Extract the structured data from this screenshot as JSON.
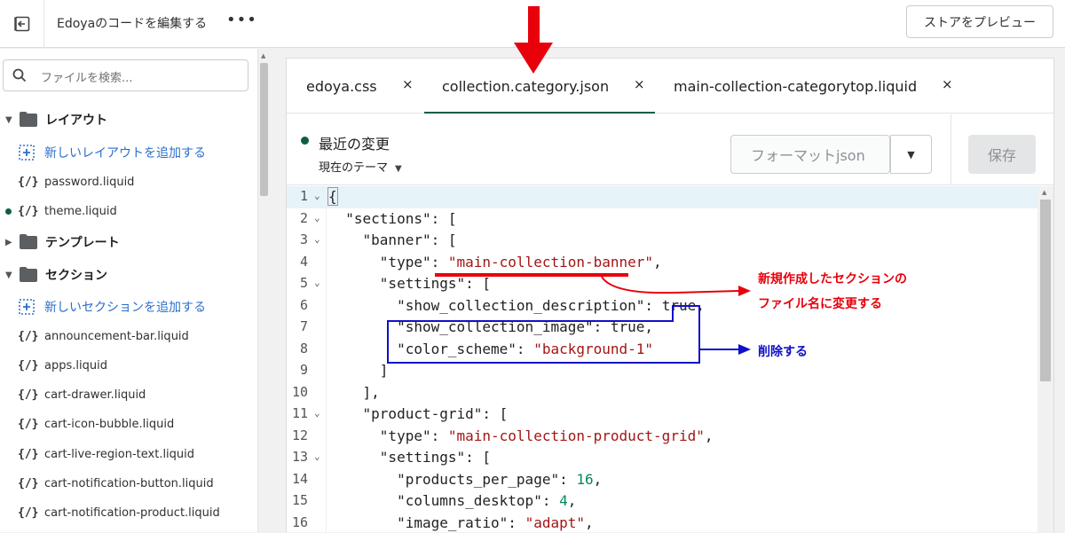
{
  "topbar": {
    "title": "Edoyaのコードを編集する",
    "more": "•••",
    "preview_label": "ストアをプレビュー"
  },
  "sidebar": {
    "search_placeholder": "ファイルを検索...",
    "layout_folder": "レイアウト",
    "add_layout": "新しいレイアウトを追加する",
    "layout_files": [
      "password.liquid",
      "theme.liquid"
    ],
    "template_folder": "テンプレート",
    "section_folder": "セクション",
    "add_section": "新しいセクションを追加する",
    "section_files": [
      "announcement-bar.liquid",
      "apps.liquid",
      "cart-drawer.liquid",
      "cart-icon-bubble.liquid",
      "cart-live-region-text.liquid",
      "cart-notification-button.liquid",
      "cart-notification-product.liquid"
    ],
    "code_icon": "{/}"
  },
  "tabs": [
    {
      "label": "edoya.css",
      "close": "×"
    },
    {
      "label": "collection.category.json",
      "close": "×"
    },
    {
      "label": "main-collection-categorytop.liquid",
      "close": "×"
    }
  ],
  "toolbar": {
    "status_label": "最近の変更",
    "theme_label": "現在のテーマ",
    "format_label": "フォーマットjson",
    "save_label": "保存"
  },
  "code_lines": [
    {
      "n": "1",
      "fold": true
    },
    {
      "n": "2",
      "fold": true
    },
    {
      "n": "3",
      "fold": true
    },
    {
      "n": "4",
      "fold": false
    },
    {
      "n": "5",
      "fold": true
    },
    {
      "n": "6",
      "fold": false
    },
    {
      "n": "7",
      "fold": false
    },
    {
      "n": "8",
      "fold": false
    },
    {
      "n": "9",
      "fold": false
    },
    {
      "n": "10",
      "fold": false
    },
    {
      "n": "11",
      "fold": true
    },
    {
      "n": "12",
      "fold": false
    },
    {
      "n": "13",
      "fold": true
    },
    {
      "n": "14",
      "fold": false
    },
    {
      "n": "15",
      "fold": false
    },
    {
      "n": "16",
      "fold": false
    }
  ],
  "code": {
    "l1": "{",
    "l2_key": "\"sections\"",
    "l2_rest": ": [",
    "l3_key": "\"banner\"",
    "l3_rest": ": [",
    "l4_key": "\"type\"",
    "l4_val": "\"main-collection-banner\"",
    "l5_key": "\"settings\"",
    "l5_rest": ": [",
    "l6_key": "\"show_collection_description\"",
    "l6_val": "true",
    "l7_key": "\"show_collection_image\"",
    "l7_val": "true",
    "l8_key": "\"color_scheme\"",
    "l8_val": "\"background-1\"",
    "l9": "]",
    "l10": "],",
    "l11_key": "\"product-grid\"",
    "l11_rest": ": [",
    "l12_key": "\"type\"",
    "l12_val": "\"main-collection-product-grid\"",
    "l13_key": "\"settings\"",
    "l13_rest": ": [",
    "l14_key": "\"products_per_page\"",
    "l14_val": "16",
    "l15_key": "\"columns_desktop\"",
    "l15_val": "4",
    "l16_key": "\"image_ratio\"",
    "l16_val": "\"adapt\""
  },
  "annotations": {
    "rename_line1": "新規作成したセクションの",
    "rename_line2": "ファイル名に変更する",
    "delete": "削除する",
    "red": "#e8000b",
    "blue": "#1010c8"
  }
}
